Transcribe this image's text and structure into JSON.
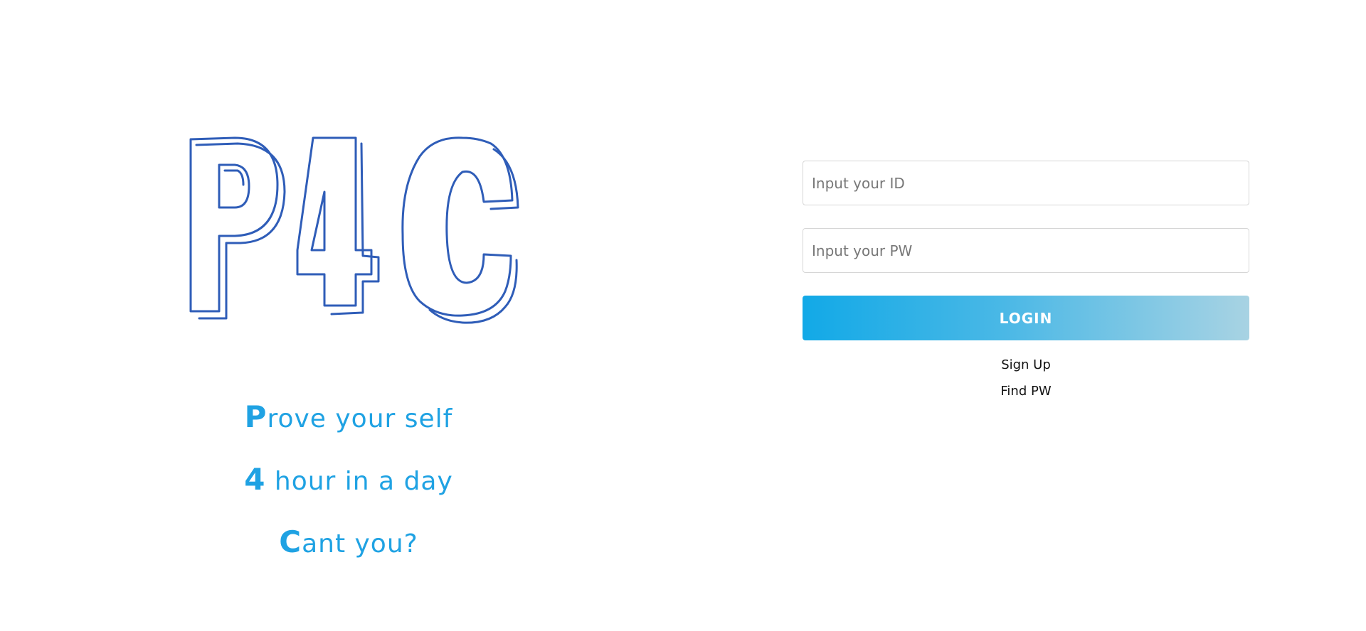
{
  "brand": {
    "logo_text": "P4C",
    "logo_color": "#2f5db8",
    "slogan": [
      {
        "lead": "P",
        "rest": "rove your self"
      },
      {
        "lead": "4",
        "rest": " hour in a day"
      },
      {
        "lead": "C",
        "rest": "ant you?"
      }
    ],
    "slogan_color": "#1fa2e3"
  },
  "login": {
    "id_placeholder": "Input your ID",
    "id_value": "",
    "pw_placeholder": "Input your PW",
    "pw_value": "",
    "login_label": "LOGIN",
    "signup_label": "Sign Up",
    "findpw_label": "Find PW"
  }
}
